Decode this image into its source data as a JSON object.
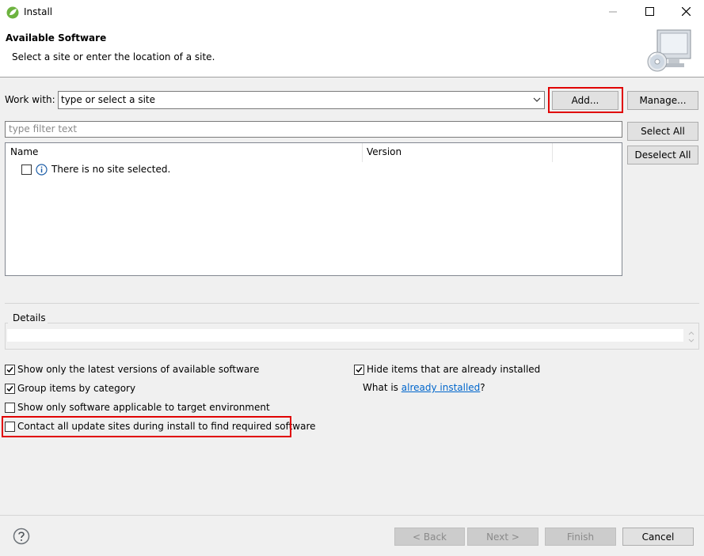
{
  "window": {
    "title": "Install",
    "minimize_icon": "minimize-icon",
    "maximize_icon": "maximize-icon",
    "close_icon": "close-icon"
  },
  "header": {
    "title": "Available Software",
    "description": "Select a site or enter the location of a site."
  },
  "work_with": {
    "label": "Work with:",
    "value": "type or select a site",
    "add_label": "Add...",
    "manage_label": "Manage..."
  },
  "filter": {
    "placeholder": "type filter text"
  },
  "buttons": {
    "select_all": "Select All",
    "deselect_all": "Deselect All"
  },
  "tree": {
    "columns": [
      "Name",
      "Version"
    ],
    "rows": [
      {
        "checked": false,
        "icon": "info-icon",
        "text": "There is no site selected."
      }
    ]
  },
  "details": {
    "label": "Details"
  },
  "options": {
    "latest_versions": {
      "label": "Show only the latest versions of available software",
      "checked": true
    },
    "group_by_category": {
      "label": "Group items by category",
      "checked": true
    },
    "target_env": {
      "label": "Show only software applicable to target environment",
      "checked": false
    },
    "contact_sites": {
      "label": "Contact all update sites during install to find required software",
      "checked": false
    },
    "hide_installed": {
      "label": "Hide items that are already installed",
      "checked": true
    },
    "what_is_prefix": "What is ",
    "what_is_link": "already installed",
    "what_is_suffix": "?"
  },
  "footer": {
    "help_icon": "help-icon",
    "back": "< Back",
    "next": "Next >",
    "finish": "Finish",
    "cancel": "Cancel"
  },
  "colors": {
    "highlight": "#e00000",
    "link": "#0066cc"
  }
}
